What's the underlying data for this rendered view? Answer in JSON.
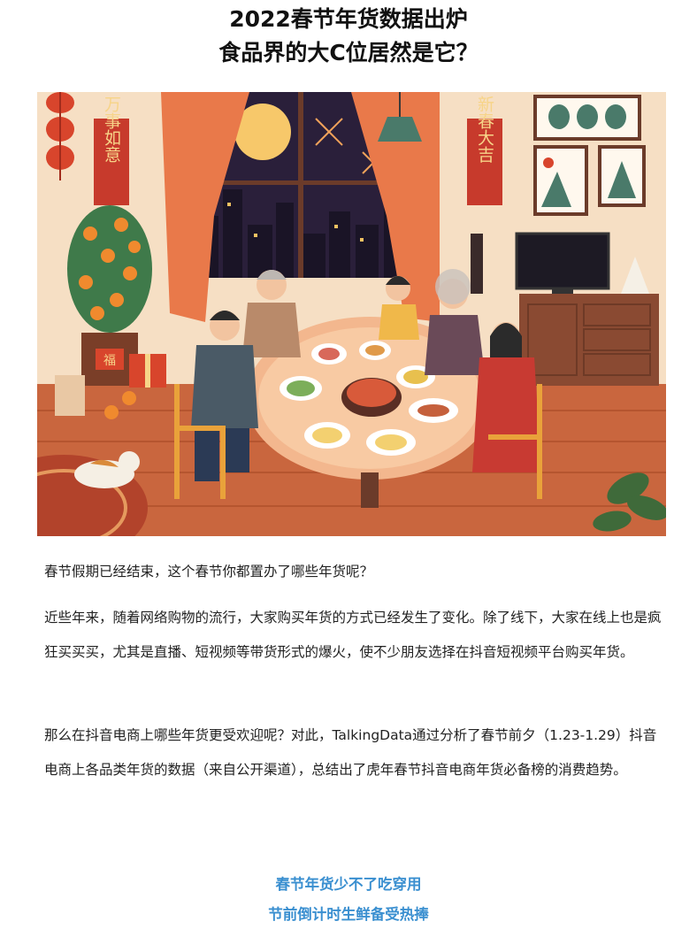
{
  "article": {
    "title_line1": "2022春节年货数据出炉",
    "title_line2": "食品界的大C位居然是它？",
    "hero_couplet_left": "万事如意",
    "hero_couplet_right": "新春大吉",
    "hero_box_label": "福",
    "paragraphs": [
      "春节假期已经结束，这个春节你都置办了哪些年货呢？",
      "近些年来，随着网络购物的流行，大家购买年货的方式已经发生了变化。除了线下，大家在线上也是疯狂买买买，尤其是直播、短视频等带货形式的爆火，使不少朋友选择在抖音短视频平台购买年货。",
      "那么在抖音电商上哪些年货更受欢迎呢？对此，TalkingData通过分析了春节前夕（1.23-1.29）抖音电商上各品类年货的数据（来自公开渠道），总结出了虎年春节抖音电商年货必备榜的消费趋势。"
    ],
    "subheading_line1": "春节年货少不了吃穿用",
    "subheading_line2": "节前倒计时生鲜备受热捧"
  },
  "colors": {
    "accent_blue": "#3a8fd0",
    "wall": "#f6dfc4",
    "curtain": "#e9794a",
    "floor": "#c9663e"
  }
}
